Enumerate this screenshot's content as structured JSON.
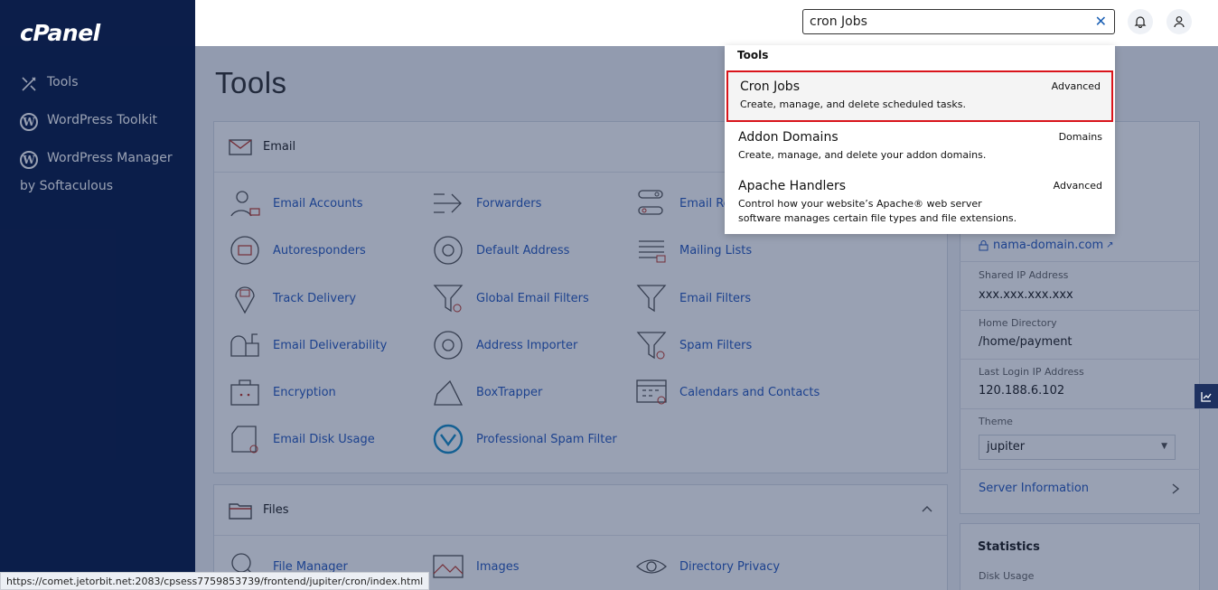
{
  "sidebar": {
    "logo": "cPanel",
    "items": [
      {
        "label": "Tools",
        "icon": "tools-icon"
      },
      {
        "label": "WordPress Toolkit",
        "icon": "wordpress-icon"
      },
      {
        "label": "WordPress Manager",
        "icon": "wordpress-icon",
        "sub": "by Softaculous"
      }
    ]
  },
  "topbar": {
    "search_value": "cron Jobs",
    "clear_icon": "close-icon",
    "notifications_icon": "bell-icon",
    "user_icon": "user-icon"
  },
  "main": {
    "title": "Tools",
    "email": {
      "heading": "Email",
      "tools": [
        "Email Accounts",
        "Forwarders",
        "Email Ro",
        "Autoresponders",
        "Default Address",
        "Mailing Lists",
        "Track Delivery",
        "Global Email Filters",
        "Email Filters",
        "Email Deliverability",
        "Address Importer",
        "Spam Filters",
        "Encryption",
        "BoxTrapper",
        "Calendars and Contacts",
        "Email Disk Usage",
        "Professional Spam Filter"
      ]
    },
    "files": {
      "heading": "Files",
      "tools": [
        "File Manager",
        "Images",
        "Directory Privacy"
      ]
    }
  },
  "right_panel": {
    "domain": "nama-domain.com",
    "shared_ip_label": "Shared IP Address",
    "shared_ip": "xxx.xxx.xxx.xxx",
    "home_dir_label": "Home Directory",
    "home_dir": "/home/payment",
    "last_login_label": "Last Login IP Address",
    "last_login": "120.188.6.102",
    "theme_label": "Theme",
    "theme": "jupiter",
    "server_info": "Server Information",
    "statistics": "Statistics",
    "disk_usage": "Disk Usage"
  },
  "dropdown": {
    "header": "Tools",
    "items": [
      {
        "title": "Cron Jobs",
        "category": "Advanced",
        "desc": "Create, manage, and delete scheduled tasks."
      },
      {
        "title": "Addon Domains",
        "category": "Domains",
        "desc": "Create, manage, and delete your addon domains."
      },
      {
        "title": "Apache Handlers",
        "category": "Advanced",
        "desc1": "Control how your website’s Apache® web server",
        "desc2": "software manages certain file types and file extensions."
      }
    ]
  },
  "statusbar": {
    "url": "https://comet.jetorbit.net:2083/cpsess7759853739/frontend/jupiter/cron/index.html"
  },
  "colors": {
    "sidebar": "#0c1e4a",
    "link": "#2a5cc0",
    "highlight": "#d9141b"
  }
}
